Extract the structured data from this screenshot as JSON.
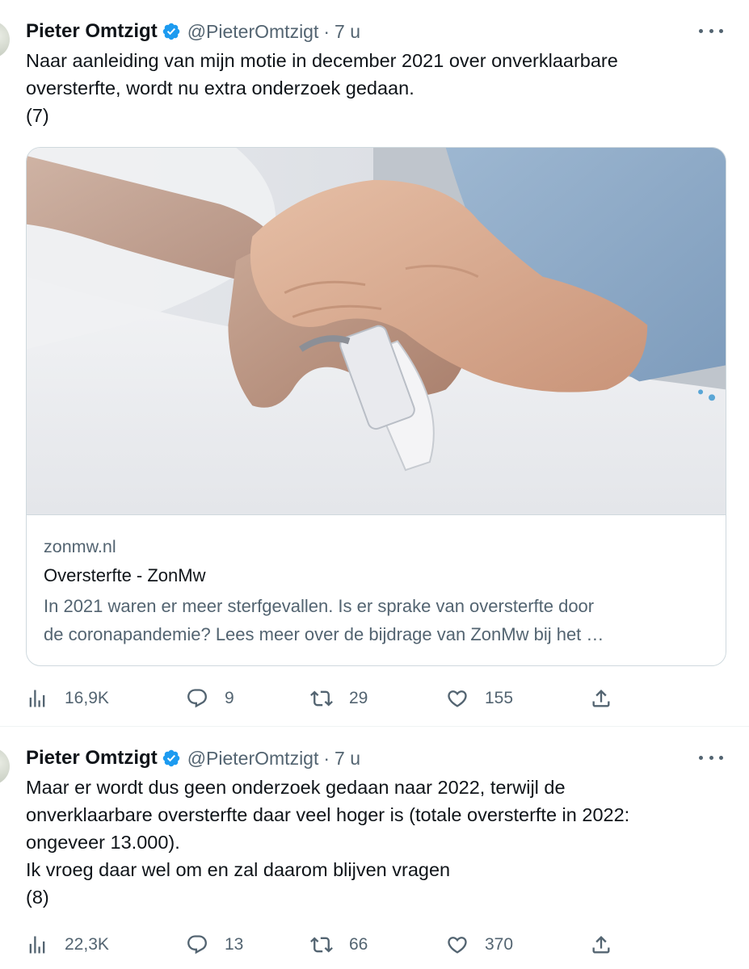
{
  "tweets": [
    {
      "author": {
        "name": "Pieter Omtzigt",
        "handle": "@PieterOmtzigt",
        "verified": true,
        "verified_color": "#1d9bf0"
      },
      "separator": "·",
      "time": "7 u",
      "text_lines": [
        "Naar aanleiding van mijn motie in december 2021 over onverklaarbare",
        "oversterfte, wordt nu extra onderzoek gedaan.",
        "(7)"
      ],
      "card": {
        "image_icon": "hospital-hands-photo",
        "domain": "zonmw.nl",
        "title": "Oversterfte - ZonMw",
        "description_lines": [
          "In 2021 waren er meer sterfgevallen. Is er sprake van oversterfte door",
          "de coronapandemie? Lees meer over de bijdrage van ZonMw bij het …"
        ]
      },
      "stats": {
        "views": "16,9K",
        "replies": "9",
        "retweets": "29",
        "likes": "155"
      }
    },
    {
      "author": {
        "name": "Pieter Omtzigt",
        "handle": "@PieterOmtzigt",
        "verified": true,
        "verified_color": "#1d9bf0"
      },
      "separator": "·",
      "time": "7 u",
      "text_lines": [
        "Maar er wordt dus geen onderzoek gedaan naar 2022, terwijl de",
        "onverklaarbare oversterfte daar veel hoger is (totale oversterfte in 2022:",
        "ongeveer 13.000).",
        "Ik vroeg daar wel om en zal daarom blijven vragen",
        "(8)"
      ],
      "stats": {
        "views": "22,3K",
        "replies": "13",
        "retweets": "66",
        "likes": "370"
      }
    }
  ],
  "colors": {
    "text": "#0f1419",
    "secondary": "#536471",
    "border": "#cfd9de",
    "accent": "#1d9bf0"
  }
}
